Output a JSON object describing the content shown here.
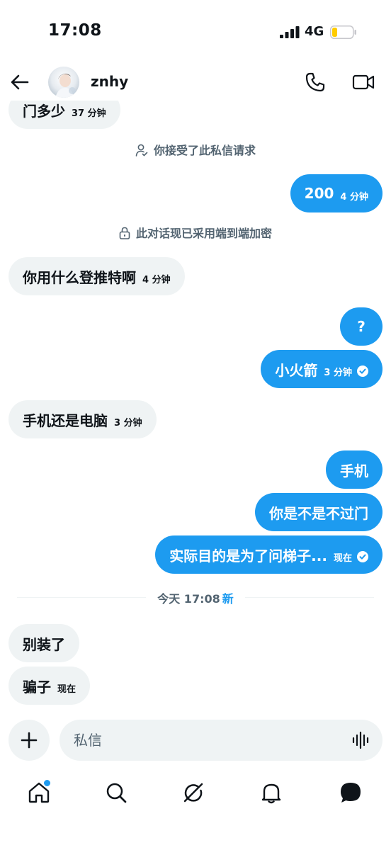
{
  "status_bar": {
    "time": "17:08",
    "network": "4G"
  },
  "header": {
    "contact_name": "znhy"
  },
  "messages": [
    {
      "direction": "in",
      "text": "门多少",
      "time": "37 分钟"
    },
    {
      "direction": "system",
      "icon": "user-check-icon",
      "text": "你接受了此私信请求"
    },
    {
      "direction": "out",
      "text": "200",
      "time": "4 分钟"
    },
    {
      "direction": "system",
      "icon": "lock-icon",
      "text": "此对话现已采用端到端加密"
    },
    {
      "direction": "in",
      "text": "你用什么登推特啊",
      "time": "4 分钟"
    },
    {
      "direction": "out",
      "text": "?"
    },
    {
      "direction": "out",
      "text": "小火箭",
      "time": "3 分钟",
      "read": true
    },
    {
      "direction": "in",
      "text": "手机还是电脑",
      "time": "3 分钟"
    },
    {
      "direction": "out",
      "text": "手机"
    },
    {
      "direction": "out",
      "text": "你是不是不过门"
    },
    {
      "direction": "out",
      "text": "实际目的是为了问梯子...",
      "time": "现在",
      "read": true
    },
    {
      "direction": "in",
      "text": "别装了"
    },
    {
      "direction": "in",
      "text": "骗子",
      "time": "现在"
    }
  ],
  "divider": {
    "label": "今天 17:08",
    "new_label": "新"
  },
  "composer": {
    "placeholder": "私信"
  },
  "nav": {
    "items": [
      "home-icon",
      "search-icon",
      "grok-icon",
      "notifications-icon",
      "messages-icon"
    ]
  },
  "colors": {
    "accent": "#1d9bf0",
    "incoming_bubble": "#eff3f4",
    "secondary_text": "#536471",
    "text": "#0f1419"
  }
}
